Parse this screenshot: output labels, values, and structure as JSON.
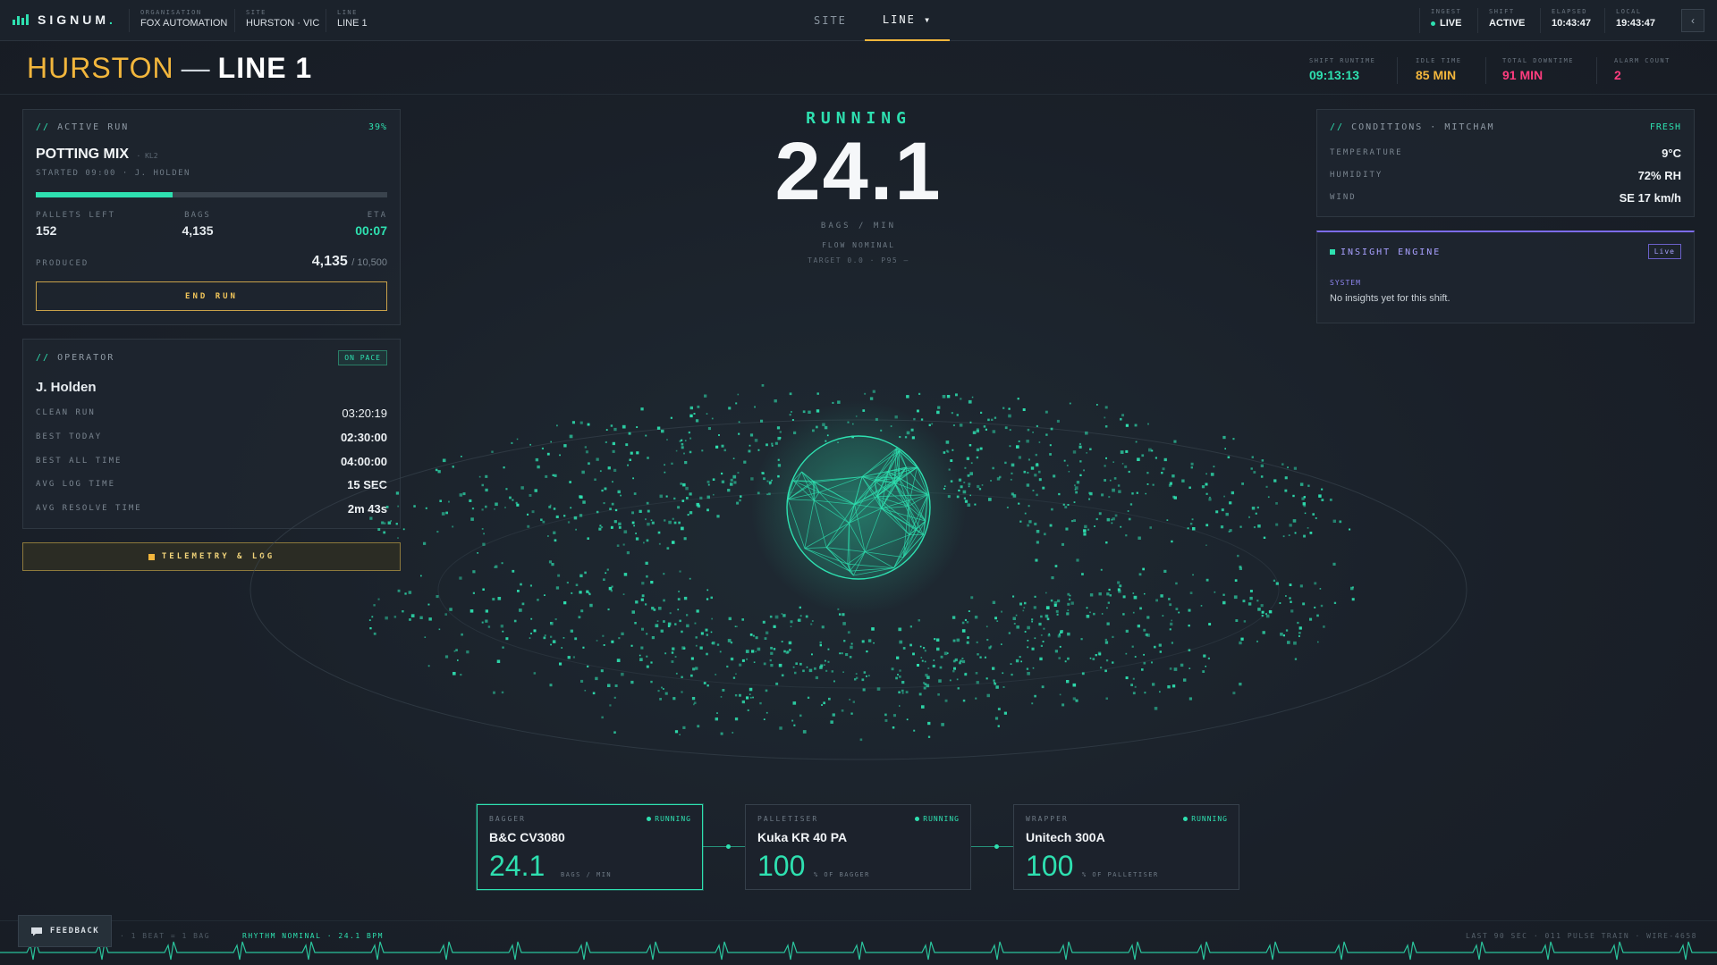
{
  "topbar": {
    "brand": "SIGNUM",
    "brand_dot": ".",
    "crumbs": [
      {
        "label": "ORGANISATION",
        "value": "FOX AUTOMATION"
      },
      {
        "label": "SITE",
        "value": "HURSTON · VIC"
      },
      {
        "label": "LINE",
        "value": "LINE 1"
      }
    ],
    "tabs": [
      {
        "label": "SITE",
        "active": false
      },
      {
        "label": "LINE ▾",
        "active": true
      }
    ],
    "status": [
      {
        "label": "INGEST",
        "value": "LIVE"
      },
      {
        "label": "SHIFT",
        "value": "ACTIVE"
      },
      {
        "label": "ELAPSED",
        "value": "10:43:47"
      },
      {
        "label": "LOCAL",
        "value": "19:43:47"
      }
    ],
    "collapse_icon": "‹"
  },
  "header": {
    "site": "HURSTON",
    "dash": "—",
    "line": "LINE 1",
    "kpis": [
      {
        "label": "SHIFT RUNTIME",
        "value": "09:13:13",
        "color": "#2ee0b0"
      },
      {
        "label": "IDLE TIME",
        "value": "85 MIN",
        "color": "#f2b63c"
      },
      {
        "label": "TOTAL DOWNTIME",
        "value": "91 MIN",
        "color": "#ff3d7f"
      },
      {
        "label": "ALARM COUNT",
        "value": "2",
        "color": "#ff3d7f"
      }
    ]
  },
  "active_run": {
    "title": "ACTIVE RUN",
    "prefix": "//",
    "percent": "39%",
    "progress": 0.39,
    "product": "POTTING MIX",
    "product_tag": "· KL2",
    "started": "STARTED 09:00 · J. HOLDEN",
    "stats": [
      {
        "label": "PALLETS LEFT",
        "value": "152"
      },
      {
        "label": "BAGS",
        "value": "4,135"
      },
      {
        "label": "ETA",
        "value": "00:07"
      }
    ],
    "produced_label": "PRODUCED",
    "produced": "4,135",
    "produced_total": "/ 10,500",
    "end_button": "END RUN"
  },
  "operator": {
    "title": "OPERATOR",
    "prefix": "//",
    "badge": "ON PACE",
    "name": "J. Holden",
    "rows": [
      {
        "label": "CLEAN RUN",
        "value": "03:20:19",
        "accent": true
      },
      {
        "label": "BEST TODAY",
        "value": "02:30:00",
        "accent": false
      },
      {
        "label": "BEST ALL TIME",
        "value": "04:00:00",
        "accent": false
      },
      {
        "label": "AVG LOG TIME",
        "value": "15 SEC",
        "accent": false
      },
      {
        "label": "AVG RESOLVE TIME",
        "value": "2m 43s",
        "accent": false
      }
    ]
  },
  "telemetry_button": "TELEMETRY & LOG",
  "center": {
    "state": "RUNNING",
    "rate": "24.1",
    "unit": "BAGS / MIN",
    "flow": "FLOW NOMINAL",
    "target": "TARGET 0.0 · P95 —"
  },
  "conditions": {
    "title": "CONDITIONS · MITCHAM",
    "prefix": "//",
    "freshness": "FRESH",
    "rows": [
      {
        "label": "TEMPERATURE",
        "value": "9°C",
        "color": "#eef2f5"
      },
      {
        "label": "HUMIDITY",
        "value": "72% RH",
        "color": "#f2b63c"
      },
      {
        "label": "WIND",
        "value": "SE 17 km/h",
        "color": "#eef2f5"
      }
    ]
  },
  "insight": {
    "title": "INSIGHT ENGINE",
    "badge": "Live",
    "source": "SYSTEM",
    "message": "No insights yet for this shift."
  },
  "machines": [
    {
      "role": "BAGGER",
      "status": "RUNNING",
      "name": "B&C CV3080",
      "value": "24.1",
      "unit": "BAGS / MIN"
    },
    {
      "role": "PALLETISER",
      "status": "RUNNING",
      "name": "Kuka KR 40 PA",
      "value": "100",
      "unit": "% OF BAGGER"
    },
    {
      "role": "WRAPPER",
      "status": "RUNNING",
      "name": "Unitech 300A",
      "value": "100",
      "unit": "% OF PALLETISER"
    }
  ],
  "footer": {
    "feedback": "FEEDBACK",
    "legend": "· 1 BEAT = 1 BAG",
    "rhythm": "RHYTHM NOMINAL · 24.1 BPM",
    "right": "LAST 90 SEC · 011 PULSE TRAIN · WIRE-4658"
  },
  "colors": {
    "accent": "#2ee0b0",
    "warn": "#f2b63c",
    "alarm": "#ff3d7f",
    "bg": "#1a2029"
  },
  "icons": {
    "logo": "signum-logo-icon",
    "feedback": "chat-bubble-icon",
    "status_dot": "status-dot-icon",
    "telemetry": "square-bullet-icon"
  }
}
